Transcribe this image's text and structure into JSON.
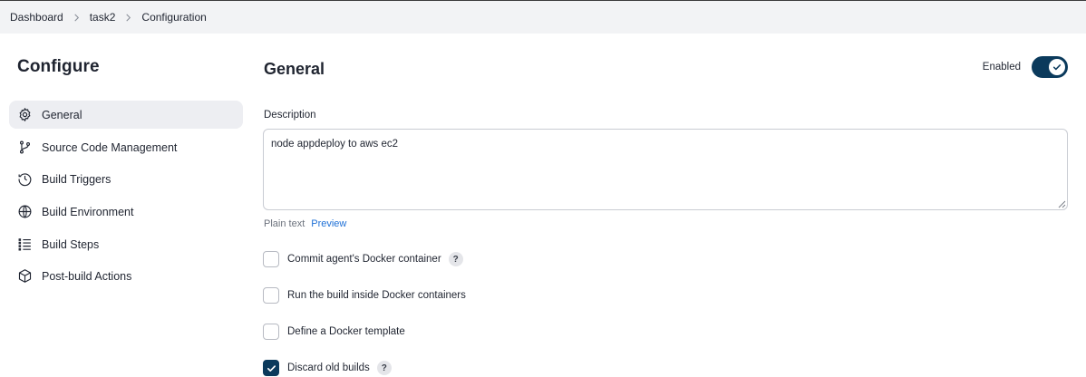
{
  "breadcrumb": {
    "items": [
      "Dashboard",
      "task2",
      "Configuration"
    ]
  },
  "sidebar": {
    "title": "Configure",
    "items": [
      {
        "label": "General",
        "icon": "gear-icon",
        "active": true
      },
      {
        "label": "Source Code Management",
        "icon": "branch-icon",
        "active": false
      },
      {
        "label": "Build Triggers",
        "icon": "clock-icon",
        "active": false
      },
      {
        "label": "Build Environment",
        "icon": "globe-icon",
        "active": false
      },
      {
        "label": "Build Steps",
        "icon": "list-icon",
        "active": false
      },
      {
        "label": "Post-build Actions",
        "icon": "cube-icon",
        "active": false
      }
    ]
  },
  "main": {
    "title": "General",
    "enabled_label": "Enabled",
    "enabled": true,
    "description_label": "Description",
    "description_value": "node appdeploy to aws ec2",
    "format_plain": "Plain text",
    "format_preview": "Preview",
    "options": [
      {
        "label": "Commit agent's Docker container",
        "checked": false,
        "help": "?"
      },
      {
        "label": "Run the build inside Docker containers",
        "checked": false,
        "help": ""
      },
      {
        "label": "Define a Docker template",
        "checked": false,
        "help": ""
      },
      {
        "label": "Discard old builds",
        "checked": true,
        "help": "?"
      }
    ]
  },
  "colors": {
    "accent": "#0b3a5c",
    "link": "#1d6fd6",
    "active_item_bg": "#edeef2",
    "breadcrumb_bg": "#f2f3f5"
  }
}
